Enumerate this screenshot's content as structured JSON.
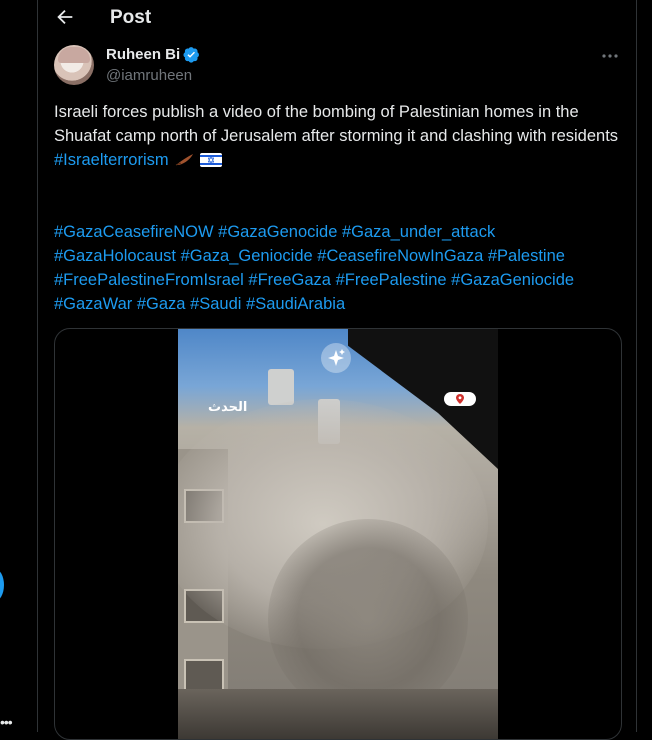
{
  "header": {
    "title": "Post"
  },
  "author": {
    "name": "Ruheen Bi",
    "handle": "@iamruheen"
  },
  "post": {
    "text": "Israeli forces publish a video of the bombing of Palestinian homes in the Shuafat camp north of Jerusalem after storming it and clashing with residents",
    "inline_hashtag": "#Israelterrorism",
    "hashtags": [
      "#GazaCeasefireNOW",
      "#GazaGenocide",
      "#Gaza_under_attack",
      "#GazaHolocaust",
      "#Gaza_Geniocide",
      "#CeasefireNowInGaza",
      "#Palestine",
      "#FreePalestineFromIsrael",
      "#FreeGaza",
      "#FreePalestine",
      "#GazaGeniocide",
      "#GazaWar",
      "#Gaza",
      "#Saudi",
      "#SaudiArabia"
    ]
  },
  "media": {
    "overlay_logo_text": "الحدث"
  },
  "icons": {
    "back": "arrow-left-icon",
    "verified": "verified-badge-icon",
    "more": "more-horizontal-icon",
    "sparkle": "sparkle-icon",
    "location": "location-pin-icon"
  },
  "colors": {
    "accent": "#1d9bf0",
    "background": "#000000",
    "text": "#e7e9ea",
    "muted": "#71767b"
  }
}
